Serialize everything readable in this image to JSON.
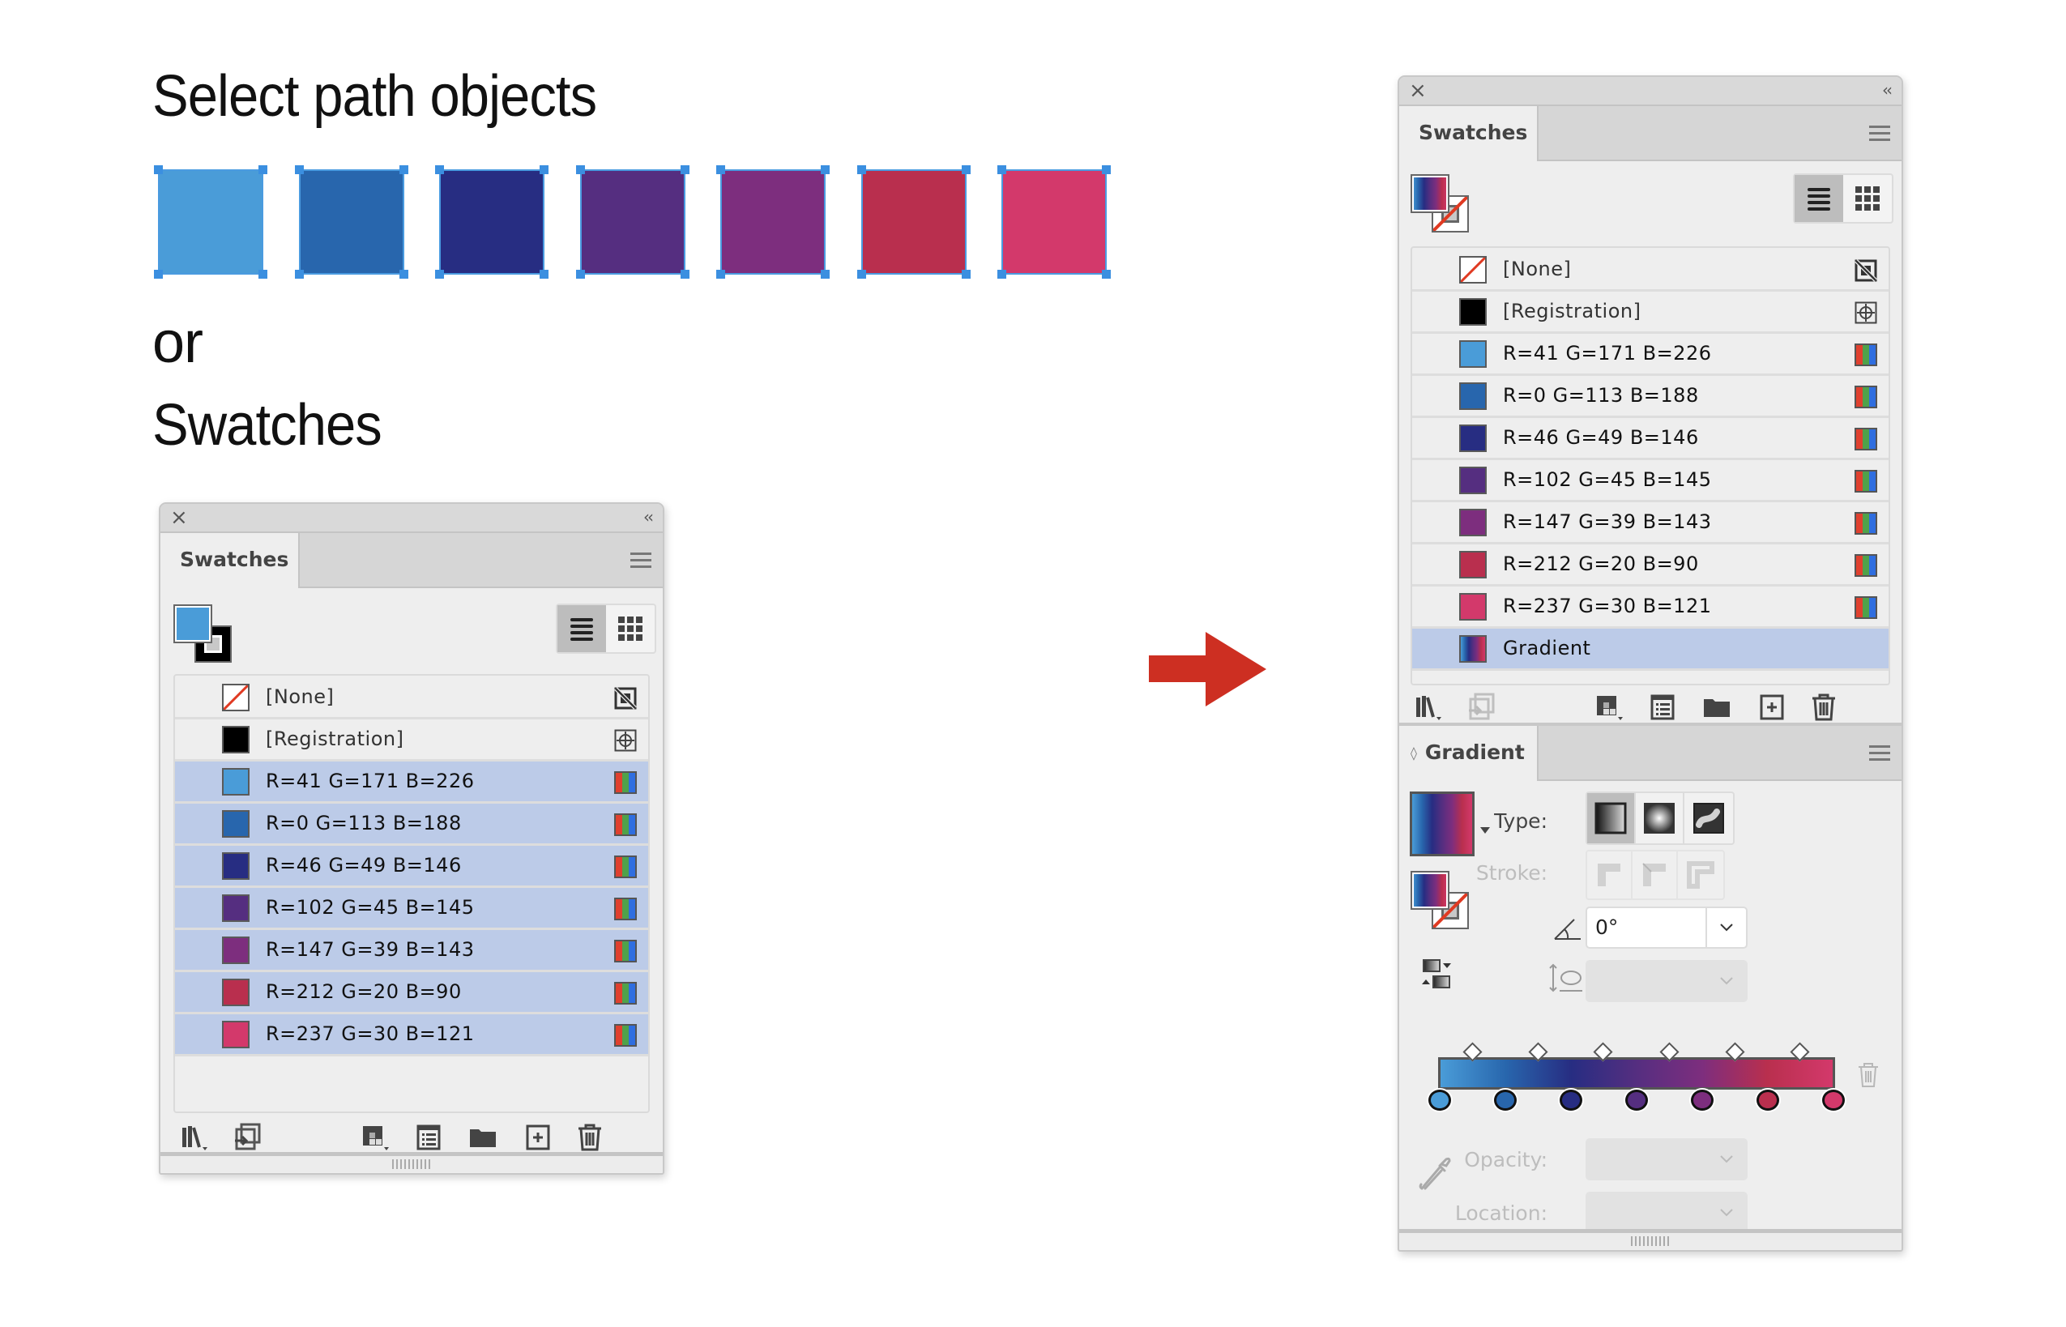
{
  "headings": {
    "select": "Select path objects",
    "or": "or",
    "swatches": "Swatches"
  },
  "path_objects": [
    {
      "name": "R=41 G=171 B=226",
      "color": "#4a9cd8"
    },
    {
      "name": "R=0 G=113 B=188",
      "color": "#2866ad"
    },
    {
      "name": "R=46 G=49 B=146",
      "color": "#272d82"
    },
    {
      "name": "R=102 G=45 B=145",
      "color": "#552e80"
    },
    {
      "name": "R=147 G=39 B=143",
      "color": "#7d2e7e"
    },
    {
      "name": "R=212 G=20 B=90",
      "color": "#b92f4e"
    },
    {
      "name": "R=237 G=30 B=121",
      "color": "#d3396b"
    }
  ],
  "arrow": {
    "color": "#cd2f22"
  },
  "left_panel": {
    "tab": "Swatches",
    "fill_color": "#4a9cd8",
    "stroke_color": "#000000",
    "swatches": [
      {
        "label": "[None]",
        "type": "none",
        "selected": false
      },
      {
        "label": "[Registration]",
        "type": "registration",
        "color": "#000000",
        "selected": false
      },
      {
        "label": "R=41 G=171 B=226",
        "type": "rgb",
        "color": "#4a9cd8",
        "selected": true
      },
      {
        "label": "R=0 G=113 B=188",
        "type": "rgb",
        "color": "#2866ad",
        "selected": true
      },
      {
        "label": "R=46 G=49 B=146",
        "type": "rgb",
        "color": "#272d82",
        "selected": true
      },
      {
        "label": "R=102 G=45 B=145",
        "type": "rgb",
        "color": "#552e80",
        "selected": true
      },
      {
        "label": "R=147 G=39 B=143",
        "type": "rgb",
        "color": "#7d2e7e",
        "selected": true
      },
      {
        "label": "R=212 G=20 B=90",
        "type": "rgb",
        "color": "#b92f4e",
        "selected": true
      },
      {
        "label": "R=237 G=30 B=121",
        "type": "rgb",
        "color": "#d3396b",
        "selected": true
      }
    ],
    "view": "list"
  },
  "right_panel": {
    "tab": "Swatches",
    "fill": "gradient",
    "stroke": "none",
    "swatches": [
      {
        "label": "[None]",
        "type": "none",
        "selected": false
      },
      {
        "label": "[Registration]",
        "type": "registration",
        "color": "#000000",
        "selected": false
      },
      {
        "label": "R=41 G=171 B=226",
        "type": "rgb",
        "color": "#4a9cd8",
        "selected": false
      },
      {
        "label": "R=0 G=113 B=188",
        "type": "rgb",
        "color": "#2866ad",
        "selected": false
      },
      {
        "label": "R=46 G=49 B=146",
        "type": "rgb",
        "color": "#272d82",
        "selected": false
      },
      {
        "label": "R=102 G=45 B=145",
        "type": "rgb",
        "color": "#552e80",
        "selected": false
      },
      {
        "label": "R=147 G=39 B=143",
        "type": "rgb",
        "color": "#7d2e7e",
        "selected": false
      },
      {
        "label": "R=212 G=20 B=90",
        "type": "rgb",
        "color": "#b92f4e",
        "selected": false
      },
      {
        "label": "R=237 G=30 B=121",
        "type": "rgb",
        "color": "#d3396b",
        "selected": false
      },
      {
        "label": "Gradient",
        "type": "gradient",
        "selected": true
      }
    ],
    "view": "list"
  },
  "gradient_panel": {
    "tab": "Gradient",
    "type_label": "Type:",
    "stroke_label": "Stroke:",
    "type_options": [
      "linear",
      "radial",
      "freeform"
    ],
    "type_selected": "linear",
    "angle_value": "0°",
    "aspect_value": "",
    "opacity_label": "Opacity:",
    "opacity_value": "",
    "location_label": "Location:",
    "location_value": "",
    "stops": [
      {
        "color": "#4a9cd8",
        "location": 0
      },
      {
        "color": "#2866ad",
        "location": 16.67
      },
      {
        "color": "#272d82",
        "location": 33.33
      },
      {
        "color": "#552e80",
        "location": 50
      },
      {
        "color": "#7d2e7e",
        "location": 66.67
      },
      {
        "color": "#b92f4e",
        "location": 83.33
      },
      {
        "color": "#d3396b",
        "location": 100
      }
    ],
    "midpoints": [
      50,
      50,
      50,
      50,
      50,
      50
    ]
  }
}
